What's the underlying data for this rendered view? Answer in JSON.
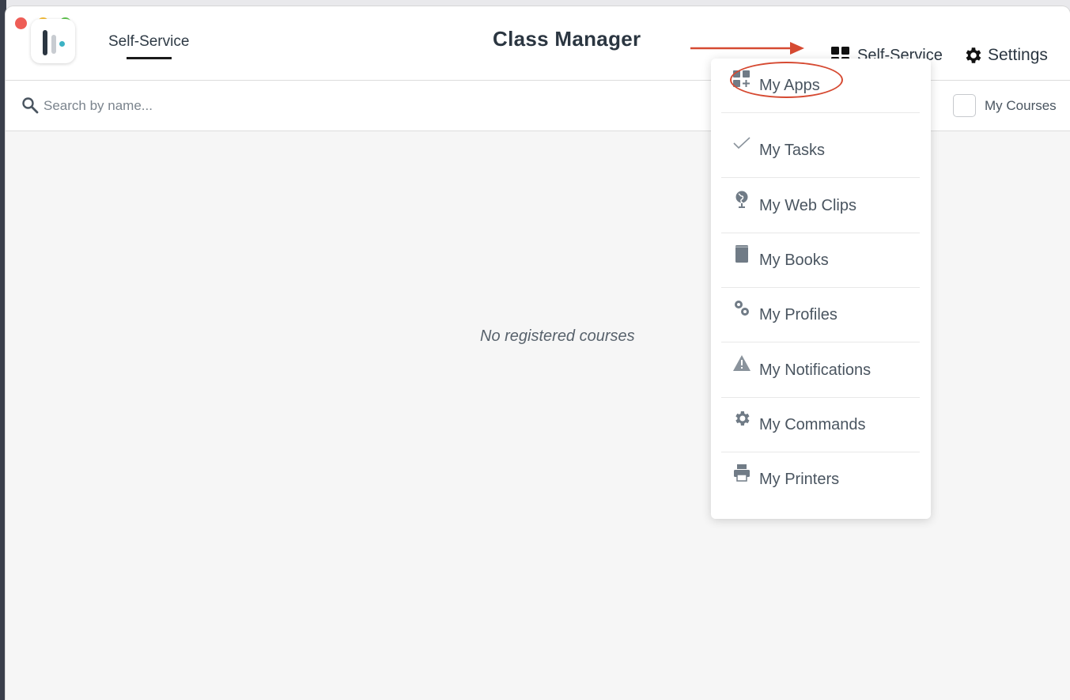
{
  "header": {
    "nav_item": "Self-Service",
    "title": "Class Manager",
    "selfservice_label": "Self-Service",
    "settings_label": "Settings"
  },
  "search": {
    "placeholder": "Search by name...",
    "value": ""
  },
  "filter": {
    "my_courses_label": "My Courses",
    "my_courses_checked": false
  },
  "main": {
    "empty_message": "No registered courses"
  },
  "dropdown": {
    "items": [
      {
        "label": "My Apps",
        "icon": "apps-icon"
      },
      {
        "label": "My Tasks",
        "icon": "checkmark-icon"
      },
      {
        "label": "My Web Clips",
        "icon": "globe-icon"
      },
      {
        "label": "My Books",
        "icon": "book-icon"
      },
      {
        "label": "My Profiles",
        "icon": "gears-icon"
      },
      {
        "label": "My Notifications",
        "icon": "warning-icon"
      },
      {
        "label": "My Commands",
        "icon": "gear-icon"
      },
      {
        "label": "My Printers",
        "icon": "printer-icon"
      }
    ]
  },
  "colors": {
    "annotation_red": "#d64a32",
    "text_dark": "#2b3641",
    "text_muted": "#4a5560",
    "logo_accent": "#3cb2c4"
  }
}
